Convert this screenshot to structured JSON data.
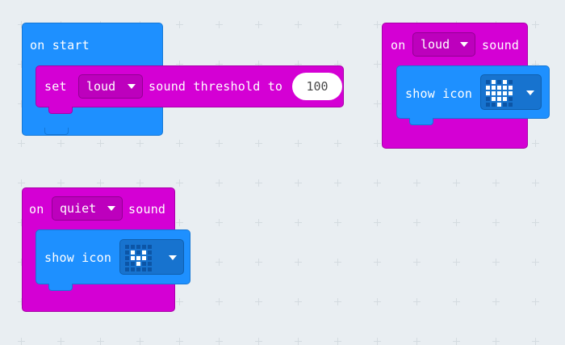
{
  "on_start": {
    "label": "on start",
    "set_block": {
      "set_label": "set",
      "level_option": "loud",
      "middle_label": "sound threshold to",
      "value": "100"
    }
  },
  "on_loud": {
    "on_label": "on",
    "sound_option": "loud",
    "sound_label": "sound",
    "show_icon_label": "show icon",
    "icon": "heart-icon",
    "icon_leds": [
      [
        0,
        1,
        0,
        1,
        0
      ],
      [
        1,
        1,
        1,
        1,
        1
      ],
      [
        1,
        1,
        1,
        1,
        1
      ],
      [
        0,
        1,
        1,
        1,
        0
      ],
      [
        0,
        0,
        1,
        0,
        0
      ]
    ]
  },
  "on_quiet": {
    "on_label": "on",
    "sound_option": "quiet",
    "sound_label": "sound",
    "show_icon_label": "show icon",
    "icon": "small-heart-icon",
    "icon_leds": [
      [
        0,
        0,
        0,
        0,
        0
      ],
      [
        0,
        1,
        0,
        1,
        0
      ],
      [
        0,
        1,
        1,
        1,
        0
      ],
      [
        0,
        0,
        1,
        0,
        0
      ],
      [
        0,
        0,
        0,
        0,
        0
      ]
    ]
  },
  "colors": {
    "workspace": "#e9eef2",
    "event_block": "#1e90ff",
    "music_block": "#d400d4",
    "basic_block": "#1e90ff",
    "led_on": "#ffffff",
    "led_off": "#0c55a6"
  }
}
